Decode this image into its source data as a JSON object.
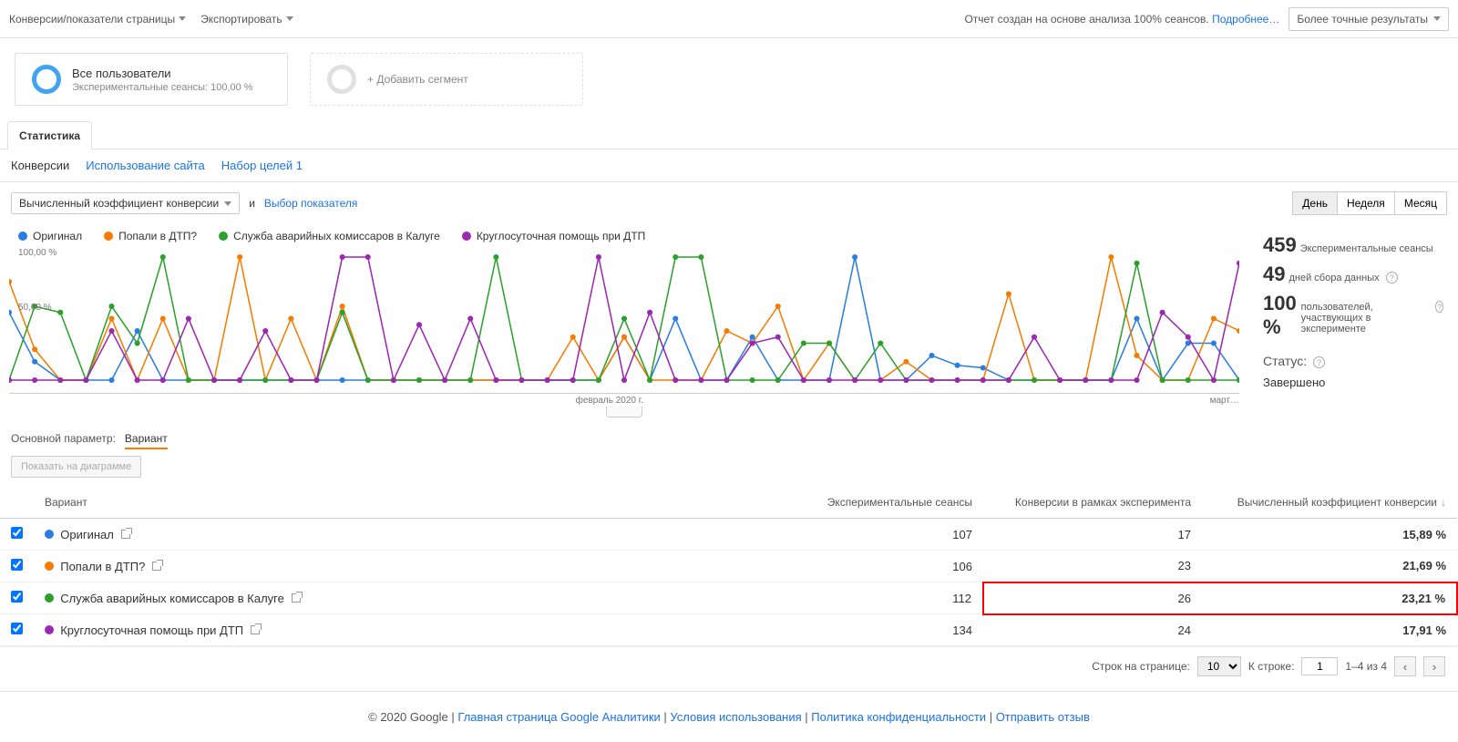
{
  "topbar": {
    "left": [
      "Конверсии/показатели страницы",
      "Экспортировать"
    ],
    "report_note_prefix": "Отчет создан на основе анализа 100% сеансов. ",
    "report_note_link": "Подробнее…",
    "results_selector": "Более точные результаты"
  },
  "segments": {
    "all_users": {
      "title": "Все пользователи",
      "sub": "Экспериментальные сеансы: 100,00 %"
    },
    "add": "+ Добавить сегмент"
  },
  "tabs": {
    "stat": "Статистика"
  },
  "subtabs": [
    "Конверсии",
    "Использование сайта",
    "Набор целей 1"
  ],
  "metric_row": {
    "metric_sel": "Вычисленный коэффициент конверсии",
    "and": "и",
    "choose": "Выбор показателя",
    "periods": [
      "День",
      "Неделя",
      "Месяц"
    ]
  },
  "chart_legend": [
    {
      "label": "Оригинал",
      "color": "#2a7de1"
    },
    {
      "label": "Попали в ДТП?",
      "color": "#f57c00"
    },
    {
      "label": "Служба аварийных комиссаров в Калуге",
      "color": "#2ca02c"
    },
    {
      "label": "Круглосуточная помощь при ДТП",
      "color": "#9c27b0"
    }
  ],
  "chart_data": {
    "type": "line",
    "ylabel": "",
    "ylim": [
      0,
      100
    ],
    "yticks": [
      "100,00 %",
      "50,00 %"
    ],
    "x_center_label": "февраль 2020 г.",
    "x_right_label": "март…",
    "x_count": 49,
    "series": [
      {
        "name": "Оригинал",
        "color": "#2a7de1",
        "values": [
          55,
          15,
          0,
          0,
          0,
          40,
          0,
          0,
          0,
          0,
          0,
          0,
          0,
          0,
          0,
          0,
          0,
          0,
          0,
          0,
          0,
          0,
          0,
          0,
          35,
          0,
          50,
          0,
          0,
          35,
          0,
          0,
          0,
          100,
          0,
          0,
          20,
          12,
          10,
          0,
          0,
          0,
          0,
          0,
          50,
          0,
          30,
          30,
          0
        ]
      },
      {
        "name": "Попали в ДТП?",
        "color": "#f57c00",
        "values": [
          80,
          25,
          0,
          0,
          50,
          0,
          50,
          0,
          0,
          100,
          0,
          50,
          0,
          60,
          0,
          0,
          0,
          0,
          0,
          0,
          0,
          0,
          35,
          0,
          35,
          0,
          0,
          0,
          40,
          30,
          60,
          0,
          30,
          0,
          0,
          15,
          0,
          0,
          0,
          70,
          0,
          0,
          0,
          100,
          20,
          0,
          0,
          50,
          40
        ]
      },
      {
        "name": "Служба аварийных комиссаров в Калуге",
        "color": "#2ca02c",
        "values": [
          0,
          60,
          55,
          0,
          60,
          30,
          100,
          0,
          0,
          0,
          0,
          0,
          0,
          55,
          0,
          0,
          0,
          0,
          0,
          100,
          0,
          0,
          0,
          0,
          50,
          0,
          100,
          100,
          0,
          0,
          0,
          30,
          30,
          0,
          30,
          0,
          0,
          0,
          0,
          0,
          0,
          0,
          0,
          0,
          95,
          0,
          0,
          0,
          0
        ]
      },
      {
        "name": "Круглосуточная помощь при ДТП",
        "color": "#9c27b0",
        "values": [
          0,
          0,
          0,
          0,
          40,
          0,
          0,
          50,
          0,
          0,
          40,
          0,
          0,
          100,
          100,
          0,
          45,
          0,
          50,
          0,
          0,
          0,
          0,
          100,
          0,
          55,
          0,
          0,
          0,
          30,
          35,
          0,
          0,
          0,
          0,
          0,
          0,
          0,
          0,
          0,
          35,
          0,
          0,
          0,
          0,
          55,
          35,
          0,
          95
        ]
      }
    ]
  },
  "summary": {
    "rows": [
      {
        "big": "459",
        "lbl": "Экспериментальные сеансы"
      },
      {
        "big": "49",
        "lbl": "дней сбора данных"
      },
      {
        "big": "100 %",
        "lbl": "пользователей, участвующих в эксперименте"
      }
    ],
    "status_lbl": "Статус:",
    "status_val": "Завершено"
  },
  "param_row": {
    "label": "Основной параметр:",
    "value": "Вариант"
  },
  "plot_btn": "Показать на диаграмме",
  "table": {
    "headers": [
      "",
      "Вариант",
      "Экспериментальные сеансы",
      "Конверсии в рамках эксперимента",
      "Вычисленный коэффициент конверсии"
    ],
    "rows": [
      {
        "color": "#2a7de1",
        "name": "Оригинал",
        "sess": "107",
        "conv": "17",
        "rate": "15,89 %",
        "hl": false
      },
      {
        "color": "#f57c00",
        "name": "Попали в ДТП?",
        "sess": "106",
        "conv": "23",
        "rate": "21,69 %",
        "hl": false
      },
      {
        "color": "#2ca02c",
        "name": "Служба аварийных комиссаров в Калуге",
        "sess": "112",
        "conv": "26",
        "rate": "23,21 %",
        "hl": true
      },
      {
        "color": "#9c27b0",
        "name": "Круглосуточная помощь при ДТП",
        "sess": "134",
        "conv": "24",
        "rate": "17,91 %",
        "hl": false
      }
    ]
  },
  "pager": {
    "rows_label": "Строк на странице:",
    "rows_value": "10",
    "goto_label": "К строке:",
    "goto_value": "1",
    "range": "1–4 из 4"
  },
  "footer": {
    "copyright": "© 2020 Google",
    "links": [
      "Главная страница Google Аналитики",
      "Условия использования",
      "Политика конфиденциальности",
      "Отправить отзыв"
    ]
  }
}
